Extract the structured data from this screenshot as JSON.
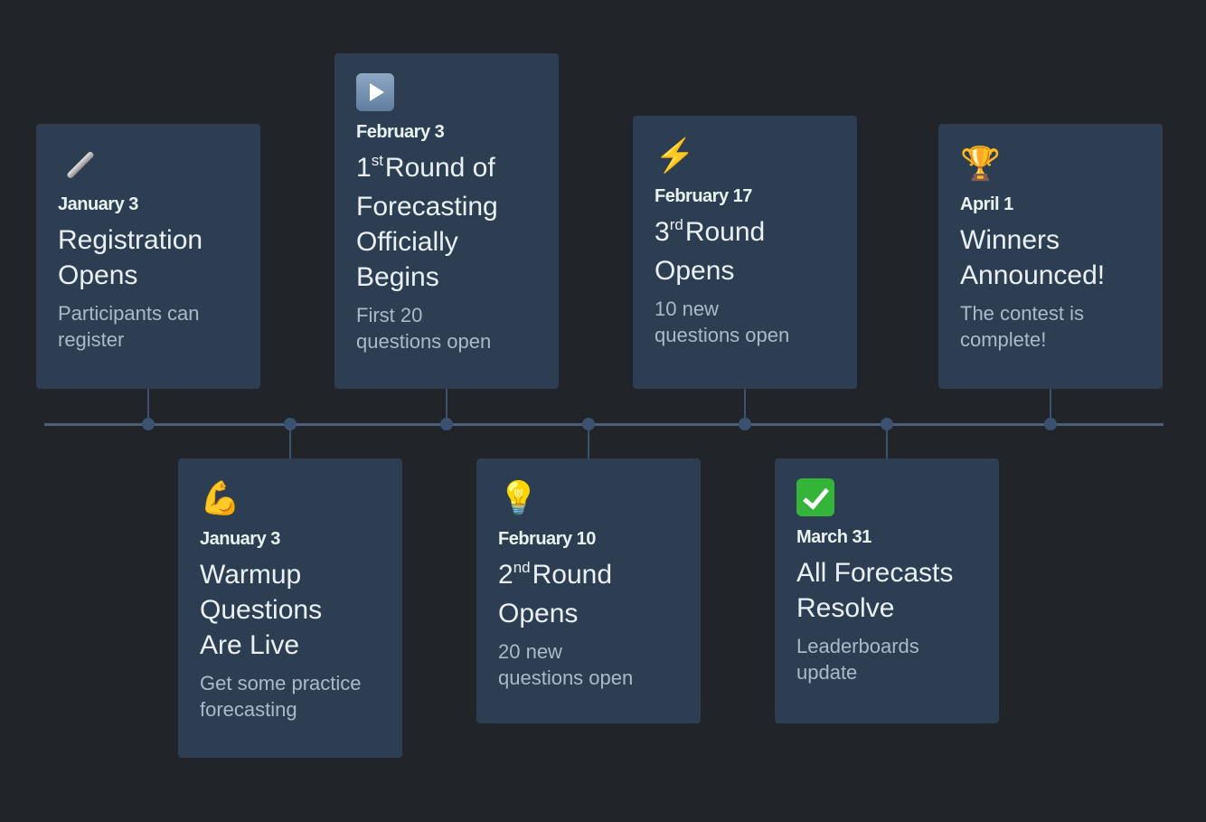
{
  "timeline": {
    "events": [
      {
        "icon": "fountain-pen-icon",
        "icon_glyph": "",
        "date": "January 3",
        "title_ordinal_num": "",
        "title_ordinal_sup": "",
        "title": "Registration Opens",
        "description": "Participants can register",
        "position": "above"
      },
      {
        "icon": "flexed-biceps-icon",
        "icon_glyph": "💪",
        "date": "January 3",
        "title_ordinal_num": "",
        "title_ordinal_sup": "",
        "title": "Warmup Questions Are Live",
        "description": "Get some practice forecasting",
        "position": "below"
      },
      {
        "icon": "play-button-icon",
        "icon_glyph": "",
        "date": "February 3",
        "title_ordinal_num": "1",
        "title_ordinal_sup": "st",
        "title": "Round of Forecasting Officially Begins",
        "description": "First 20 questions open",
        "position": "above"
      },
      {
        "icon": "light-bulb-icon",
        "icon_glyph": "💡",
        "date": "February 10",
        "title_ordinal_num": "2",
        "title_ordinal_sup": "nd",
        "title": "Round Opens",
        "description": "20 new questions open",
        "position": "below"
      },
      {
        "icon": "lightning-bolt-icon",
        "icon_glyph": "⚡",
        "date": "February 17",
        "title_ordinal_num": "3",
        "title_ordinal_sup": "rd",
        "title": "Round Opens",
        "description": "10 new questions open",
        "position": "above"
      },
      {
        "icon": "check-mark-icon",
        "icon_glyph": "",
        "date": "March 31",
        "title_ordinal_num": "",
        "title_ordinal_sup": "",
        "title": "All Forecasts Resolve",
        "description": "Leaderboards update",
        "position": "below"
      },
      {
        "icon": "trophy-icon",
        "icon_glyph": "🏆",
        "date": "April 1",
        "title_ordinal_num": "",
        "title_ordinal_sup": "",
        "title": "Winners Announced!",
        "description": "The contest is complete!",
        "position": "above"
      }
    ]
  },
  "colors": {
    "background": "#212429",
    "card": "#2d3e52",
    "axis": "#4b5f78",
    "node": "#3a5270",
    "date_text": "#e8f3ef",
    "title_text": "#eaf1f6",
    "description_text": "#a9bacd"
  }
}
